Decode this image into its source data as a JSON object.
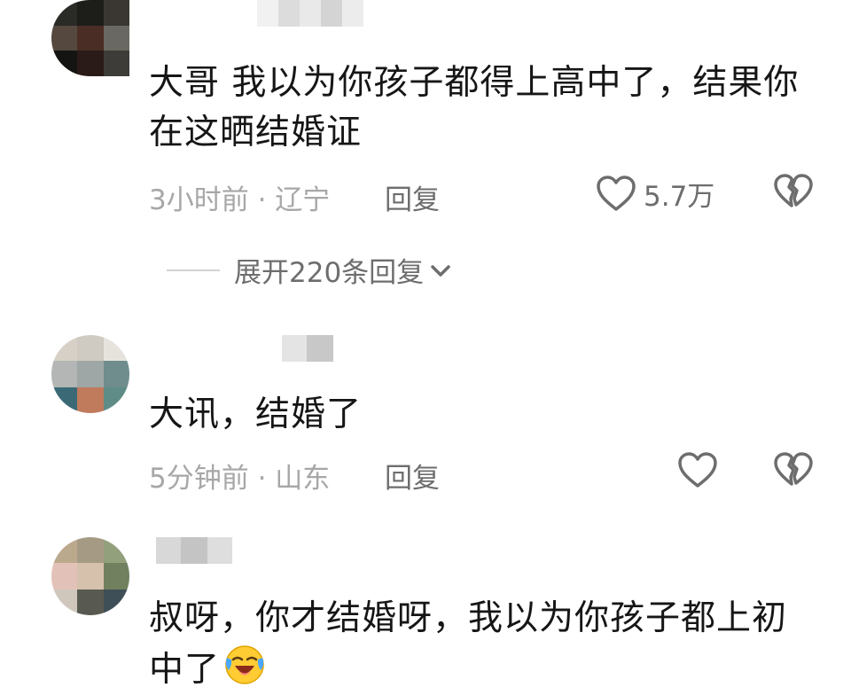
{
  "comments": [
    {
      "text_line1": "大哥  我以为你孩子都得上高中了，结果你",
      "text_line2": "在这晒结婚证",
      "meta": "3小时前 · 辽宁",
      "reply_label": "回复",
      "like_count": "5.7万",
      "expand_label": "展开220条回复"
    },
    {
      "text_line1": "大讯，结婚了",
      "meta": "5分钟前 · 山东",
      "reply_label": "回复",
      "like_count": ""
    },
    {
      "text_line1": "叔呀，你才结婚呀，我以为你孩子都上初",
      "text_line2": "中了"
    }
  ],
  "icons": {
    "like": "heart-outline-icon",
    "dislike": "broken-heart-icon",
    "expand": "chevron-down-icon",
    "emoji": "laughing-crying-emoji"
  },
  "colors": {
    "text": "#161616",
    "meta": "#a7a7a7",
    "action": "#6d6d6d"
  }
}
